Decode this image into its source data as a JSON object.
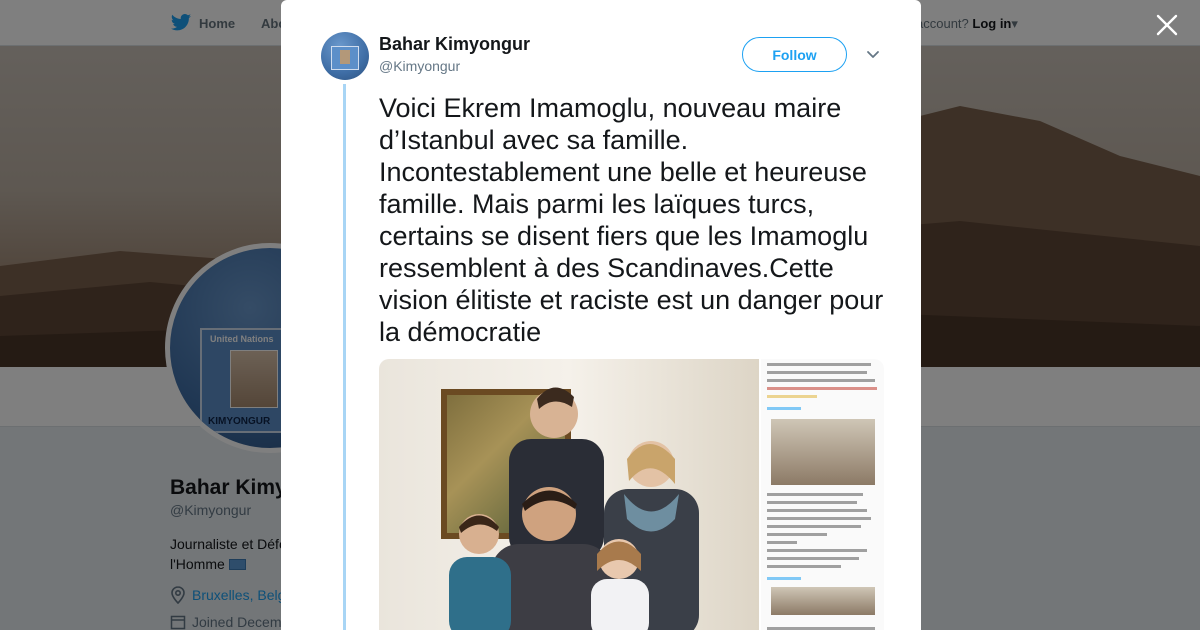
{
  "background": {
    "nav": {
      "home_label": "Home",
      "about_label": "Abo",
      "account_prompt": "account?",
      "login_label": "Log in"
    },
    "profile": {
      "avatar_card_org": "United Nations",
      "avatar_card_name": "KIMYONGUR",
      "name": "Bahar Kimy",
      "handle": "@Kimyongur",
      "bio_line1": "Journaliste et Défe",
      "bio_line2": "l'Homme",
      "location": "Bruxelles, Belg",
      "joined": "Joined Decem"
    }
  },
  "tweet": {
    "author_name": "Bahar Kimyongur",
    "author_handle": "@Kimyongur",
    "follow_label": "Follow",
    "text": "Voici Ekrem Imamoglu, nouveau maire d’Istanbul avec sa famille. Incontestablement une belle et heureuse famille. Mais parmi les laïques turcs, certains se disent fiers que les Imamoglu ressemblent à des Scandinaves.Cette vision élitiste et raciste est un danger pour la démocratie"
  },
  "icons": {
    "twitter": "bird-icon",
    "close": "close-icon",
    "caret": "chevron-down-icon",
    "location": "location-pin-icon",
    "calendar": "calendar-icon"
  },
  "colors": {
    "accent": "#1da1f2",
    "thread_line": "#a8d5f5",
    "overlay": "rgba(0,0,0,0.5)"
  }
}
